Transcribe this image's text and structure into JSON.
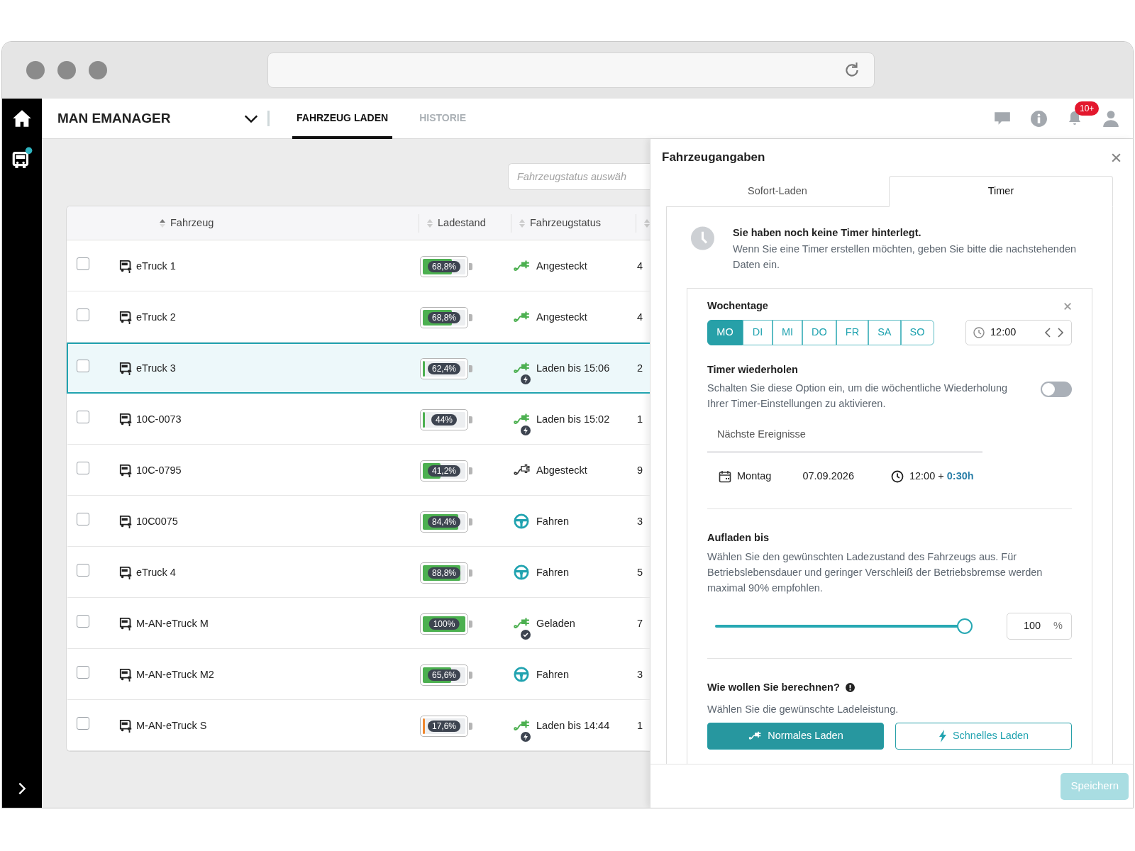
{
  "header": {
    "title": "MAN EMANAGER",
    "tabs": [
      {
        "label": "FAHRZEUG LADEN",
        "selected": true
      },
      {
        "label": "HISTORIE",
        "selected": false
      }
    ],
    "notification_count": "10+"
  },
  "filter": {
    "placeholder": "Fahrzeugstatus auswäh"
  },
  "table": {
    "columns": [
      {
        "label": "Fahrzeug"
      },
      {
        "label": "Ladestand"
      },
      {
        "label": "Fahrzeugstatus"
      }
    ],
    "rows": [
      {
        "checked": false,
        "selected": false,
        "vehicle": "eTruck 1",
        "charge": "68,8%",
        "level": 0.69,
        "color": "#4cb050",
        "kind": "plugged",
        "status": "Angesteckt",
        "column_4": "4"
      },
      {
        "checked": false,
        "selected": false,
        "vehicle": "eTruck 2",
        "charge": "68,8%",
        "level": 0.69,
        "color": "#4cb050",
        "kind": "plugged",
        "status": "Angesteckt",
        "column_4": "4"
      },
      {
        "checked": false,
        "selected": true,
        "vehicle": "eTruck 3",
        "charge": "62,4%",
        "level": 0.05,
        "color": "#4cb050",
        "kind": "charging",
        "status": "Laden bis 15:06",
        "column_4": "2"
      },
      {
        "checked": false,
        "selected": false,
        "vehicle": "10C-0073",
        "charge": "44%",
        "level": 0.05,
        "color": "#4cb050",
        "kind": "charging",
        "status": "Laden bis 15:02",
        "column_4": "1"
      },
      {
        "checked": false,
        "selected": false,
        "vehicle": "10C-0795",
        "charge": "41,2%",
        "level": 0.41,
        "color": "#4cb050",
        "kind": "unplugged",
        "status": "Abgesteckt",
        "column_4": "9"
      },
      {
        "checked": false,
        "selected": false,
        "vehicle": "10C0075",
        "charge": "84,4%",
        "level": 0.84,
        "color": "#4cb050",
        "kind": "driving",
        "status": "Fahren",
        "column_4": "3"
      },
      {
        "checked": false,
        "selected": false,
        "vehicle": "eTruck 4",
        "charge": "88,8%",
        "level": 0.89,
        "color": "#4cb050",
        "kind": "driving",
        "status": "Fahren",
        "column_4": "5"
      },
      {
        "checked": false,
        "selected": false,
        "vehicle": "M-AN-eTruck M",
        "charge": "100%",
        "level": 1,
        "color": "#4cb050",
        "kind": "charged",
        "status": "Geladen",
        "column_4": "7"
      },
      {
        "checked": false,
        "selected": false,
        "vehicle": "M-AN-eTruck M2",
        "charge": "65,6%",
        "level": 0.66,
        "color": "#4cb050",
        "kind": "driving",
        "status": "Fahren",
        "column_4": "3"
      },
      {
        "checked": false,
        "selected": false,
        "vehicle": "M-AN-eTruck S",
        "charge": "17,6%",
        "level": 0.04,
        "color": "#f0872e",
        "kind": "charging",
        "status": "Laden bis 14:44",
        "column_4": "1"
      }
    ]
  },
  "panel": {
    "title": "Fahrzeugangaben",
    "tabs": [
      {
        "label": "Sofort-Laden",
        "selected": false
      },
      {
        "label": "Timer",
        "selected": true
      }
    ],
    "notice": {
      "title": "Sie haben noch keine Timer hinterlegt.",
      "text": "Wenn Sie eine Timer erstellen möchten, geben Sie bitte die nachstehenden Daten ein."
    },
    "weekdays": {
      "title": "Wochentage",
      "days": [
        {
          "label": "MO",
          "selected": true
        },
        {
          "label": "DI",
          "selected": false
        },
        {
          "label": "MI",
          "selected": false
        },
        {
          "label": "DO",
          "selected": false
        },
        {
          "label": "FR",
          "selected": false
        },
        {
          "label": "SA",
          "selected": false
        },
        {
          "label": "SO",
          "selected": false
        }
      ],
      "time": "12:00"
    },
    "repeat": {
      "title": "Timer wiederholen",
      "text": "Schalten Sie diese Option ein, um die wöchentliche Wiederholung Ihrer Timer-Einstellungen zu aktivieren.",
      "on": false
    },
    "events": {
      "title": "Nächste Ereignisse",
      "day": "Montag",
      "date": "07.09.2026",
      "time": "12:00 + **0:30h**"
    },
    "charge_to": {
      "title": "Aufladen bis",
      "text": "Wählen Sie den gewünschten Ladezustand des Fahrzeugs aus. Für Betriebslebensdauer und geringer Verschleiß der Betriebsbremse werden maximal 90% empfohlen.",
      "level": 1,
      "value": "100",
      "unit": "%"
    },
    "mode": {
      "title": "Wie wollen Sie berechnen?",
      "text": "Wählen Sie die gewünschte Ladeleistung.",
      "options": [
        {
          "label": "Normales Laden",
          "kind": "normal",
          "selected": true
        },
        {
          "label": "Schnelles Laden",
          "kind": "fast",
          "selected": false
        }
      ]
    },
    "save_button": {
      "label": "Speichern",
      "disabled": true
    }
  }
}
